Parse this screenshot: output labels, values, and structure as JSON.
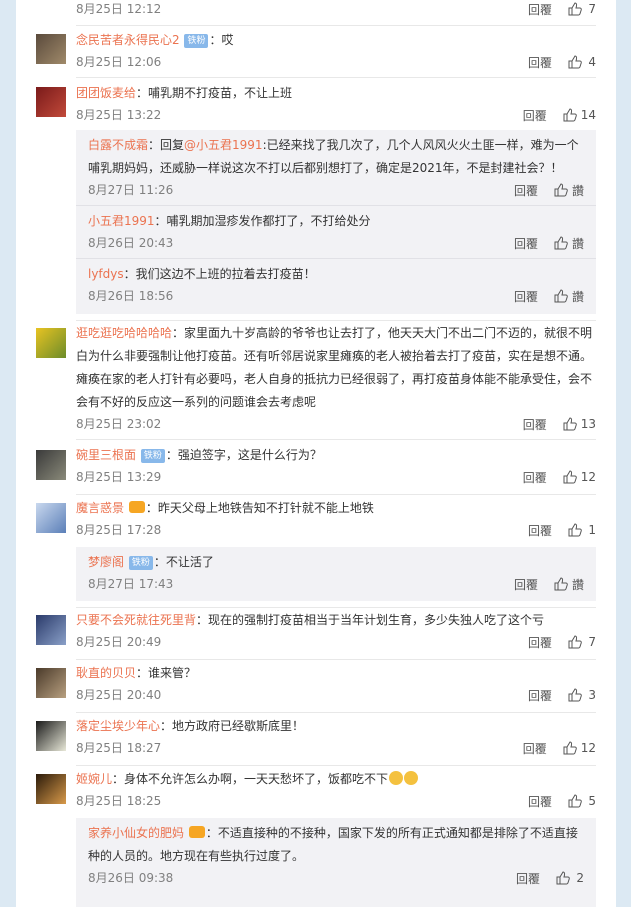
{
  "ui": {
    "reply": "回覆",
    "like_word": "讚"
  },
  "comments": [
    {
      "user": "",
      "text": "",
      "time": "8月25日 12:12",
      "likes": "7"
    },
    {
      "user": "念民苦者永得民心2",
      "badge": "铁粉",
      "text": "：哎",
      "time": "8月25日 12:06",
      "likes": "4"
    },
    {
      "user": "团团饭麦给",
      "text": "：哺乳期不打疫苗，不让上班",
      "time": "8月25日 13:22",
      "likes": "14",
      "replies": [
        {
          "user": "白露不成霜",
          "text_a": "：回复",
          "mention": "@小五君1991",
          "text_b": ":已经来找了我几次了，几个人风风火火土匪一样，难为一个哺乳期妈妈，还威胁一样说这次不打以后都别想打了，确定是2021年，不是封建社会？！",
          "time": "8月27日 11:26"
        },
        {
          "user": "小五君1991",
          "text": "：哺乳期加湿疹发作都打了，不打给处分",
          "time": "8月26日 20:43"
        },
        {
          "user": "lyfdys",
          "text": "：我们这边不上班的拉着去打疫苗！",
          "time": "8月26日 18:56"
        }
      ]
    },
    {
      "user": "逛吃逛吃哈哈哈哈",
      "text": "：家里面九十岁高龄的爷爷也让去打了，他天天大门不出二门不迈的，就很不明白为什么非要强制让他打疫苗。还有听邻居说家里瘫痪的老人被抬着去打了疫苗，实在是想不通。瘫痪在家的老人打针有必要吗，老人自身的抵抗力已经很弱了，再打疫苗身体能不能承受住，会不会有不好的反应这一系列的问题谁会去考虑呢",
      "time": "8月25日 23:02",
      "likes": "13"
    },
    {
      "user": "碗里三根面",
      "badge": "铁粉",
      "text": "：强迫签字，这是什么行为？",
      "time": "8月25日 13:29",
      "likes": "12"
    },
    {
      "user": "魔言惑景",
      "text": "：昨天父母上地铁告知不打针就不能上地铁",
      "time": "8月25日 17:28",
      "likes": "1",
      "replies": [
        {
          "user": "梦廖阁",
          "badge": "铁粉",
          "text": "：不让活了",
          "time": "8月27日 17:43"
        }
      ]
    },
    {
      "user": "只要不会死就往死里背",
      "text": "：现在的强制打疫苗相当于当年计划生育，多少失独人吃了这个亏",
      "time": "8月25日 20:49",
      "likes": "7"
    },
    {
      "user": "耿直的贝贝",
      "text": "：谁来管？",
      "time": "8月25日 20:40",
      "likes": "3"
    },
    {
      "user": "落定尘埃少年心",
      "text": "：地方政府已经歇斯底里！",
      "time": "8月25日 18:27",
      "likes": "12"
    },
    {
      "user": "姬婉儿",
      "text": "：身体不允许怎么办啊，一天天愁坏了，饭都吃不下",
      "time": "8月25日 18:25",
      "likes": "5",
      "replies": [
        {
          "user": "家养小仙女的肥妈",
          "text": "：不适直接种的不接种，国家下发的所有正式通知都是排除了不适直接种的人员的。地方现在有些执行过度了。",
          "time": "8月26日 09:38",
          "likes": "2"
        }
      ]
    }
  ]
}
